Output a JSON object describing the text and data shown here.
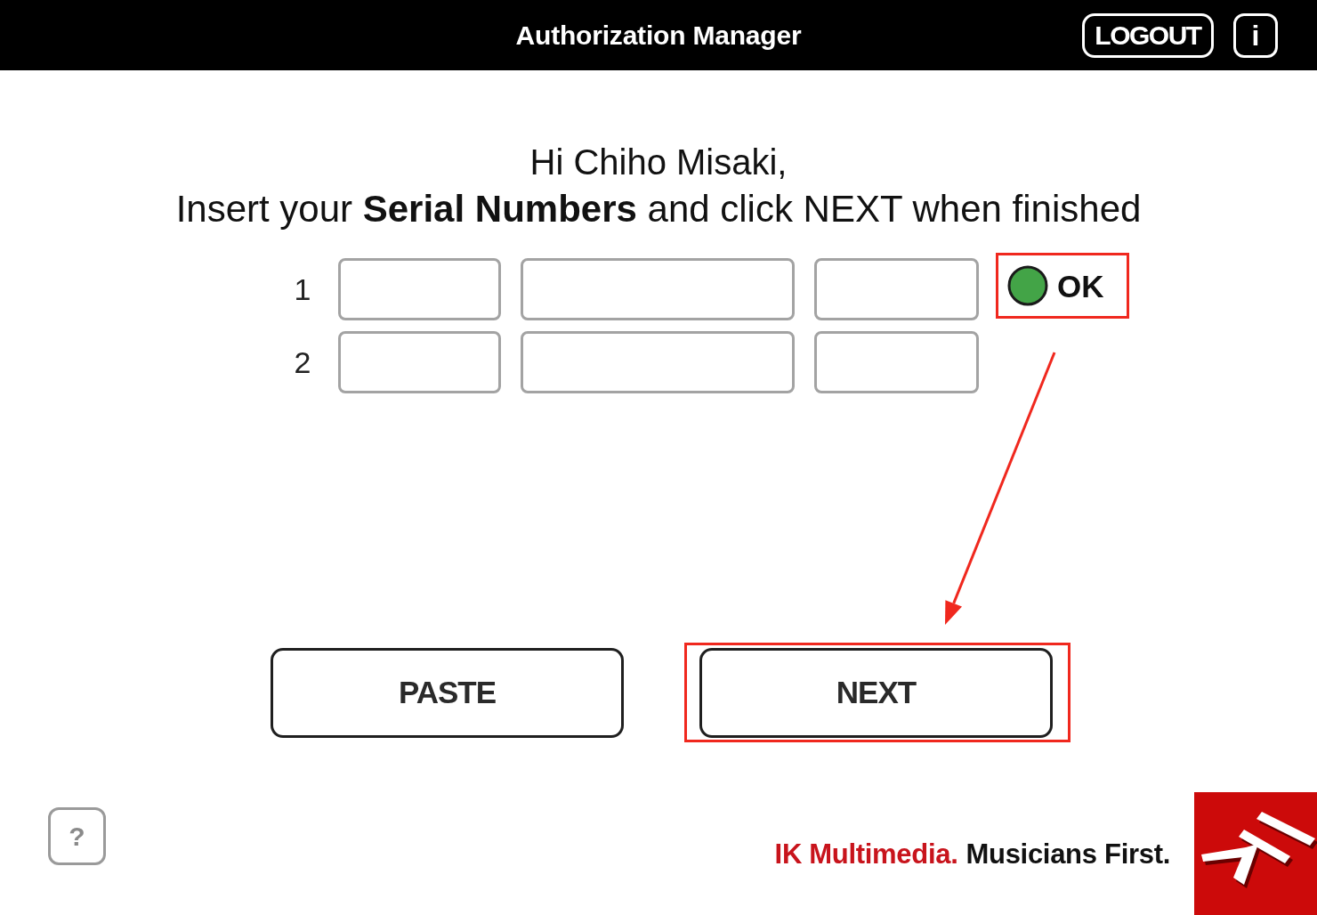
{
  "window": {
    "title": "Authorization Manager"
  },
  "header_buttons": {
    "logout": "LOGOUT",
    "info": "i"
  },
  "greeting": "Hi Chiho Misaki,",
  "instruction": "Insert your **Serial Numbers** and click NEXT when finished",
  "serial_rows": [
    {
      "number": "1",
      "status": {
        "label": "OK",
        "color": "#43a447",
        "highlighted": true
      }
    },
    {
      "number": "2"
    }
  ],
  "buttons": [
    {
      "label": "PASTE",
      "highlighted": false
    },
    {
      "label": "NEXT",
      "highlighted": true
    }
  ],
  "help_button": {
    "label": "?"
  },
  "footer": {
    "brand": "IK Multimedia.",
    "slogan": "Musicians First."
  }
}
